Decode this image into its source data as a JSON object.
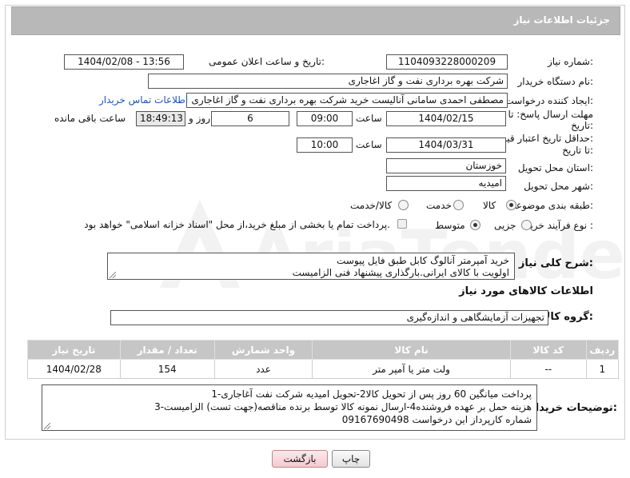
{
  "header": {
    "title": "جزئیات اطلاعات نیاز"
  },
  "fields": {
    "need_number_label": "شماره نیاز:",
    "need_number": "1104093228000209",
    "announce_label": "تاریخ و ساعت اعلان عمومی:",
    "announce_value": "1404/02/08 - 13:56",
    "buyer_label": "نام دستگاه خریدار:",
    "buyer_value": "شرکت بهره برداری نفت و گاز اغاجاری",
    "creator_label": "ایجاد کننده درخواست:",
    "creator_value": "مصطفی احمدی سامانی آنالیست خرید شرکت بهره برداری نفت و گاز اغاجاری",
    "contact_link": "اطلاعات تماس خریدار",
    "deadline_label_1": "مهلت ارسال پاسخ: تا",
    "deadline_label_2": "تاریخ:",
    "deadline_date": "1404/02/15",
    "time_label": "ساعت",
    "deadline_time": "09:00",
    "days_value": "6",
    "days_label": "روز و",
    "remaining_time": "18:49:13",
    "remaining_label": "ساعت باقی مانده",
    "validity_label_1": "حداقل تاریخ اعتبار قیمت:",
    "validity_label_2": "تا تاریخ:",
    "validity_date": "1404/03/31",
    "validity_time": "10:00",
    "province_label": "استان محل تحویل:",
    "province_value": "خوزستان",
    "city_label": "شهر محل تحویل:",
    "city_value": "امیدیه",
    "category_label": "طبقه بندی موضوعی:",
    "category_options": [
      "کالا",
      "خدمت",
      "کالا/خدمت"
    ],
    "category_selected": "کالا",
    "process_label": "نوع فرآیند خرید :",
    "process_options": [
      "جزیی",
      "متوسط"
    ],
    "process_selected": "متوسط",
    "payment_note": "پرداخت تمام یا بخشی از مبلغ خرید،از محل \"اسناد خزانه اسلامی\" خواهد بود.",
    "summary_label": "شرح کلی نیاز:",
    "summary_lines": [
      "خرید آمپرمتر آنالوگ کابل طبق فایل پیوست",
      "اولویت با کالای ایرانی.بارگذاری پیشنهاد فنی الزامیست"
    ],
    "items_section_title": "اطلاعات کالاهای مورد نیاز",
    "goods_group_label": "گروه کالا:",
    "goods_group_value": "تجهیزات آزمایشگاهی و اندازه‌گیری"
  },
  "table": {
    "headers": [
      "ردیف",
      "کد کالا",
      "نام کالا",
      "واحد شمارش",
      "تعداد / مقدار",
      "تاریخ نیاز"
    ],
    "rows": [
      [
        "1",
        "--",
        "ولت متر یا آمپر متر",
        "عدد",
        "154",
        "1404/02/28"
      ]
    ]
  },
  "notes": {
    "label": "توضیحات خریدار:",
    "lines": [
      "1-پرداخت میانگین 60 روز پس از تحویل کالا2-تحویل امیدیه شرکت نفت آغاجاری",
      "3-هزینه حمل بر عهده فروشنده4-ارسال نمونه کالا توسط برنده مناقصه(جهت تست) الزامیست",
      "شماره کارپرداز این درخواست 09167690498"
    ]
  },
  "buttons": {
    "print": "چاپ",
    "back": "بازگشت"
  },
  "watermark": {
    "text": "AriaTender.neT"
  },
  "colors": {
    "titlebar": "#b8b8b8",
    "table_header": "#c6c6c6",
    "link": "#1a56b8",
    "back_button": "#f4c9d1"
  }
}
